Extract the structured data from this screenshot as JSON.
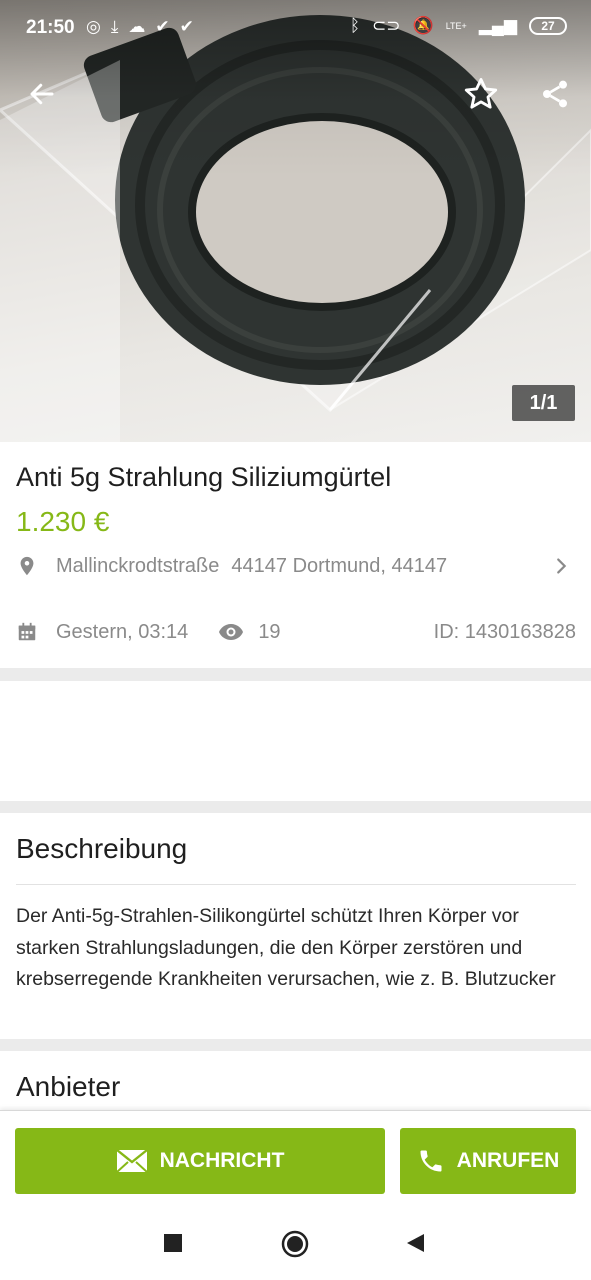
{
  "status_bar": {
    "time": "21:50",
    "left_icons": [
      "app-badge-icon",
      "download-icon",
      "cloud-icon",
      "check-icon",
      "check-icon"
    ],
    "right_icons": [
      "bluetooth-icon",
      "toggle-icon",
      "bell-off-icon",
      "signal-icon"
    ],
    "network": "LTE+",
    "battery": "27"
  },
  "gallery": {
    "counter": "1/1",
    "icons": {
      "back": "arrow-left-icon",
      "favorite": "star-outline-icon",
      "share": "share-icon"
    }
  },
  "listing": {
    "title": "Anti 5g Strahlung Siliziumgürtel",
    "price": "1.230 €",
    "street": "Mallinckrodtstraße",
    "city": "44147 Dortmund, 44147",
    "date": "Gestern, 03:14",
    "views": "19",
    "id": "ID: 1430163828"
  },
  "description": {
    "heading": "Beschreibung",
    "text": "Der Anti-5g-Strahlen-Silikongürtel schützt Ihren Körper vor starken Strahlungsladungen, die den Körper zerstören und krebserregende Krankheiten verursachen, wie z. B. Blutzucker"
  },
  "seller": {
    "heading": "Anbieter"
  },
  "actions": {
    "message_label": "NACHRICHT",
    "call_label": "ANRUFEN"
  },
  "colors": {
    "accent": "#86b817",
    "text_muted": "#8a8a8a"
  }
}
